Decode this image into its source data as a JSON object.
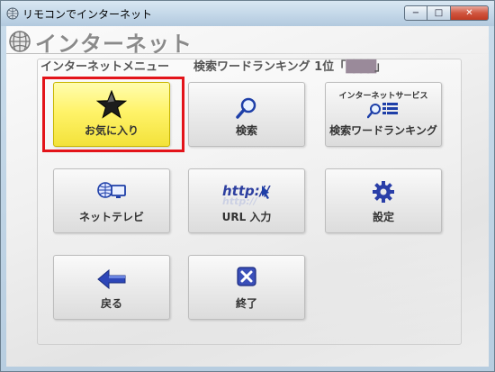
{
  "window": {
    "title": "リモコンでインターネット",
    "controls": {
      "minimize": "−",
      "maximize": "□",
      "close": "✕"
    }
  },
  "header": {
    "title": "インターネット"
  },
  "sections": {
    "menu_label": "インターネットメニュー",
    "ranking_label": "検索ワードランキング 1位「",
    "ranking_value": "████",
    "ranking_close": "」"
  },
  "tiles": {
    "favorites": {
      "label": "お気に入り",
      "icon": "star-icon"
    },
    "search": {
      "label": "検索",
      "icon": "magnifier-icon"
    },
    "ranking": {
      "label": "検索ワードランキング",
      "sublabel": "インターネットサービス",
      "icon": "ranking-list-icon"
    },
    "nettv": {
      "label": "ネットテレビ",
      "icon": "net-tv-icon"
    },
    "url": {
      "label": "URL 入力",
      "icon": "url-input-icon"
    },
    "settings": {
      "label": "設定",
      "icon": "gear-icon"
    },
    "back": {
      "label": "戻る",
      "icon": "back-arrow-icon"
    },
    "exit": {
      "label": "終了",
      "icon": "close-box-icon"
    }
  },
  "colors": {
    "selected_tile": "#fff36a",
    "selection_frame": "#e3141a",
    "label_text": "#333333"
  }
}
